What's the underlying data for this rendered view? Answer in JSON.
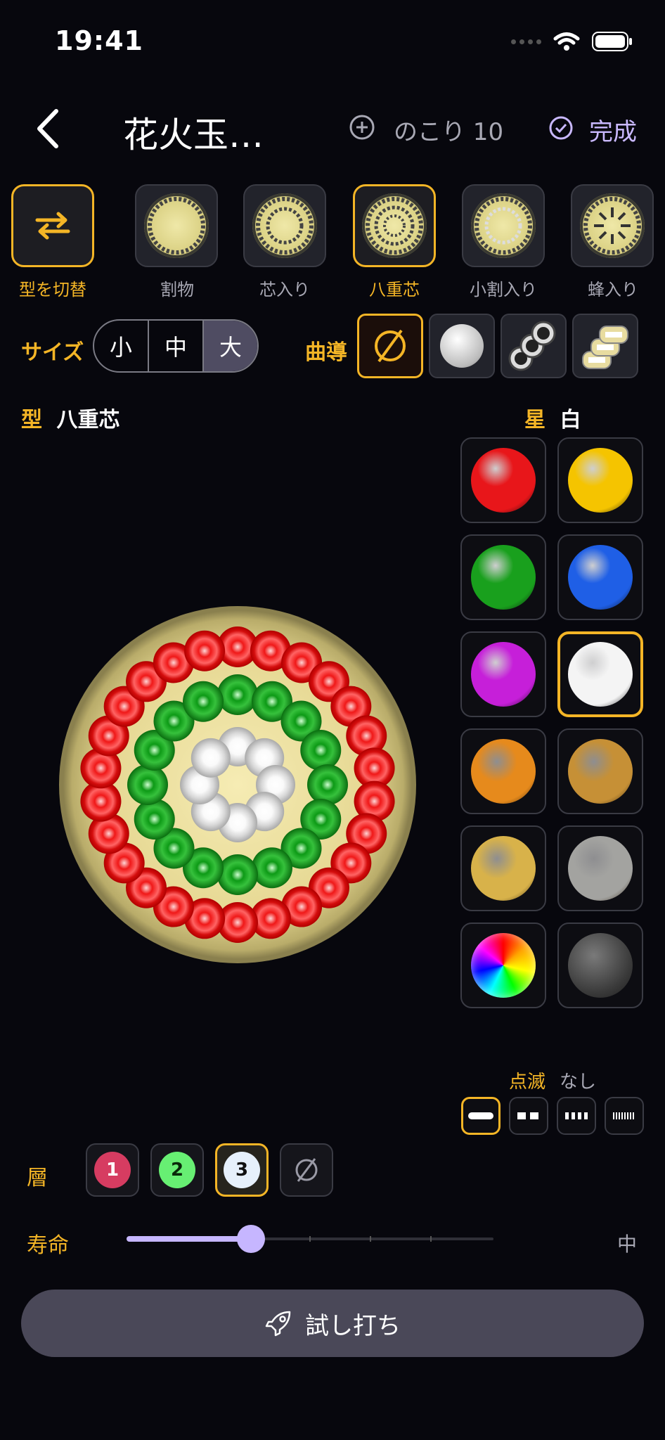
{
  "status_bar": {
    "time": "19:41"
  },
  "nav": {
    "title": "花火玉…",
    "remaining": "のこり 10",
    "done": "完成"
  },
  "type_row": {
    "switch_label": "型を切替",
    "items": [
      "割物",
      "芯入り",
      "八重芯",
      "小割入り",
      "蜂入り"
    ],
    "selected": "八重芯"
  },
  "size": {
    "label": "サイズ",
    "options": [
      "小",
      "中",
      "大"
    ],
    "selected": "大"
  },
  "guide": {
    "label": "曲導"
  },
  "shape": {
    "label": "型",
    "value": "八重芯"
  },
  "star": {
    "label": "星",
    "value": "白",
    "colors": [
      {
        "name": "red",
        "hex": "#e8161a"
      },
      {
        "name": "yellow",
        "hex": "#f5c400"
      },
      {
        "name": "green",
        "hex": "#19a01d"
      },
      {
        "name": "blue",
        "hex": "#1f5fe6"
      },
      {
        "name": "purple",
        "hex": "#c61fd9"
      },
      {
        "name": "white",
        "hex": "#f4f4f4"
      },
      {
        "name": "orange-glitter",
        "hex": "#e68a1c"
      },
      {
        "name": "gold-glitter",
        "hex": "#c69036"
      },
      {
        "name": "yellow-glitter",
        "hex": "#d8b24a"
      },
      {
        "name": "silver-glitter",
        "hex": "#a3a3a0"
      },
      {
        "name": "rainbow",
        "hex": "#ff00ff"
      },
      {
        "name": "dark",
        "hex": "#4a4a4a"
      }
    ],
    "selected": "white"
  },
  "blink": {
    "label": "点滅",
    "value": "なし"
  },
  "layers": {
    "label": "層",
    "items": [
      "1",
      "2",
      "3"
    ],
    "selected": "3"
  },
  "lifetime": {
    "label": "寿命",
    "value": "中",
    "level": 0.34
  },
  "launch": {
    "label": "試し打ち"
  },
  "colors": {
    "accent": "#f4b526",
    "purple": "#c6b6ff"
  }
}
